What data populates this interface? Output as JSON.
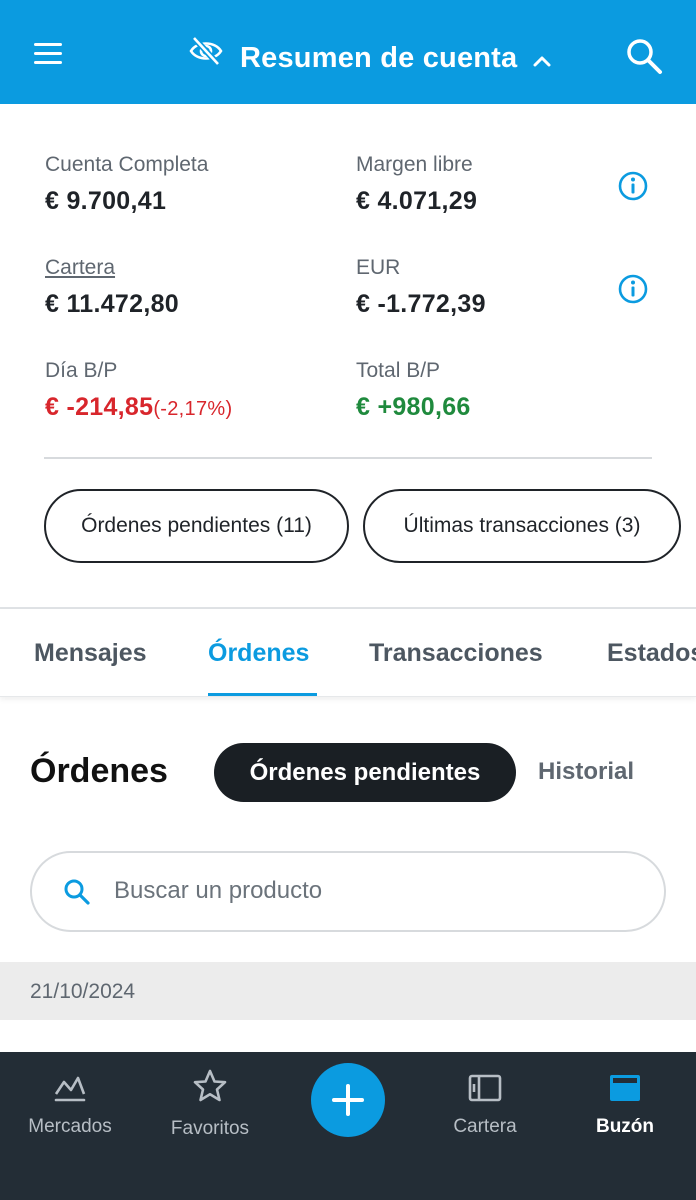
{
  "header": {
    "title": "Resumen de cuenta",
    "menu_icon": "hamburger-menu-icon",
    "privacy_icon": "eye-off-icon",
    "search_icon": "search-icon",
    "color": "#0b9be0"
  },
  "summary": {
    "cuenta_completa": {
      "label": "Cuenta Completa",
      "value": "€ 9.700,41"
    },
    "margen_libre": {
      "label": "Margen libre",
      "value": "€ 4.071,29"
    },
    "cartera": {
      "label": "Cartera",
      "value": "€ 11.472,80"
    },
    "eur": {
      "label": "EUR",
      "value": "€ -1.772,39"
    },
    "dia_bp": {
      "label": "Día B/P",
      "value": "€ -214,85",
      "percent": "(-2,17%)"
    },
    "total_bp": {
      "label": "Total B/P",
      "value": "€ +980,66"
    },
    "negative_color": "#d8262c",
    "positive_color": "#1f8a3d"
  },
  "quick_buttons": {
    "pending_orders": "Órdenes pendientes (11)",
    "last_transactions": "Últimas transacciones (3)"
  },
  "tabs": [
    {
      "label": "Mensajes",
      "active": false
    },
    {
      "label": "Órdenes",
      "active": true
    },
    {
      "label": "Transacciones",
      "active": false
    },
    {
      "label": "Estados",
      "active": false
    }
  ],
  "orders": {
    "title": "Órdenes",
    "segment_active": "Órdenes pendientes",
    "segment_inactive": "Historial",
    "search_placeholder": "Buscar un producto",
    "date_group": "21/10/2024"
  },
  "bottom_nav": {
    "items": [
      {
        "label": "Mercados",
        "icon": "chart-icon",
        "active": false
      },
      {
        "label": "Favoritos",
        "icon": "star-icon",
        "active": false
      },
      {
        "label": "Cartera",
        "icon": "wallet-icon",
        "active": false
      },
      {
        "label": "Buzón",
        "icon": "inbox-icon",
        "active": true
      }
    ],
    "fab_icon": "plus-icon"
  }
}
